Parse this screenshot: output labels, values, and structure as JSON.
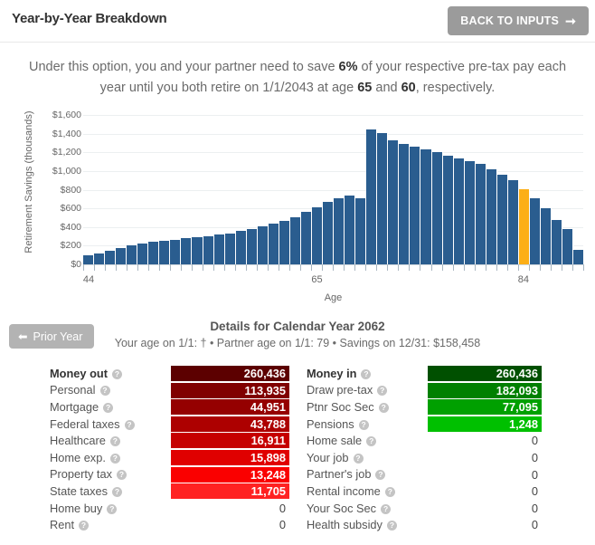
{
  "header": {
    "title": "Year-by-Year Breakdown",
    "back_button": "BACK TO INPUTS",
    "back_icon": "arrow-right-icon"
  },
  "intro": {
    "part1": "Under this option, you and your partner need to save ",
    "savings_rate": "6%",
    "part2": " of your respective pre-tax pay each year until you both retire on 1/1/2043 at age ",
    "your_age": "65",
    "part3": " and ",
    "partner_age": "60",
    "part4": ", respectively."
  },
  "details": {
    "prior_button": "Prior Year",
    "prior_icon": "arrow-left-icon",
    "title": "Details for Calendar Year 2062",
    "subtitle": "Your age on 1/1: † • Partner age on 1/1: 79 • Savings on 12/31: $158,458"
  },
  "money_out": {
    "header_label": "Money out",
    "header_value": "260,436",
    "rows": [
      {
        "label": "Personal",
        "value": "113,935",
        "color": "#800000"
      },
      {
        "label": "Mortgage",
        "value": "44,951",
        "color": "#950000"
      },
      {
        "label": "Federal taxes",
        "value": "43,788",
        "color": "#ad0000"
      },
      {
        "label": "Healthcare",
        "value": "16,911",
        "color": "#c60000"
      },
      {
        "label": "Home exp.",
        "value": "15,898",
        "color": "#e00000"
      },
      {
        "label": "Property tax",
        "value": "13,248",
        "color": "#fa0000"
      },
      {
        "label": "State taxes",
        "value": "11,705",
        "color": "#ff2222"
      },
      {
        "label": "Home buy",
        "value": "0",
        "color": ""
      },
      {
        "label": "Rent",
        "value": "0",
        "color": ""
      }
    ],
    "header_color": "#5c0000"
  },
  "money_in": {
    "header_label": "Money in",
    "header_value": "260,436",
    "rows": [
      {
        "label": "Draw pre-tax",
        "value": "182,093",
        "color": "#008000"
      },
      {
        "label": "Ptnr Soc Sec",
        "value": "77,095",
        "color": "#00a000"
      },
      {
        "label": "Pensions",
        "value": "1,248",
        "color": "#00c000"
      },
      {
        "label": "Home sale",
        "value": "0",
        "color": ""
      },
      {
        "label": "Your job",
        "value": "0",
        "color": ""
      },
      {
        "label": "Partner's job",
        "value": "0",
        "color": ""
      },
      {
        "label": "Rental income",
        "value": "0",
        "color": ""
      },
      {
        "label": "Your Soc Sec",
        "value": "0",
        "color": ""
      },
      {
        "label": "Health subsidy",
        "value": "0",
        "color": ""
      }
    ],
    "header_color": "#005000"
  },
  "help_icon_glyph": "?",
  "chart_data": {
    "type": "bar",
    "title": "",
    "xlabel": "Age",
    "ylabel": "Retirement Savings (thousands)",
    "ylim": [
      0,
      1700
    ],
    "ytick_values": [
      0,
      200,
      400,
      600,
      800,
      1000,
      1200,
      1400,
      1600
    ],
    "ytick_labels": [
      "$0",
      "$200",
      "$400",
      "$600",
      "$800",
      "$1,000",
      "$1,200",
      "$1,400",
      "$1,600"
    ],
    "grid": true,
    "legend": false,
    "bar_color": "#2a5d8f",
    "highlight_color": "#fcaf17",
    "highlight_index": 40,
    "xtick_labels": [
      "44",
      "65",
      "84"
    ],
    "xtick_indices": [
      0,
      21,
      40
    ],
    "categories": [
      44,
      45,
      46,
      47,
      48,
      49,
      50,
      51,
      52,
      53,
      54,
      55,
      56,
      57,
      58,
      59,
      60,
      61,
      62,
      63,
      64,
      65,
      66,
      67,
      68,
      69,
      70,
      71,
      72,
      73,
      74,
      75,
      76,
      77,
      78,
      79,
      80,
      81,
      82,
      83,
      84
    ],
    "values": [
      95,
      118,
      145,
      172,
      200,
      228,
      240,
      248,
      262,
      278,
      292,
      305,
      318,
      332,
      355,
      380,
      408,
      440,
      468,
      505,
      560,
      610,
      668,
      712,
      740,
      712,
      1448,
      1408,
      1330,
      1292,
      1262,
      1232,
      1200,
      1165,
      1132,
      1105,
      1078,
      1020,
      962,
      900,
      810,
      705,
      600,
      480,
      380,
      158
    ]
  }
}
